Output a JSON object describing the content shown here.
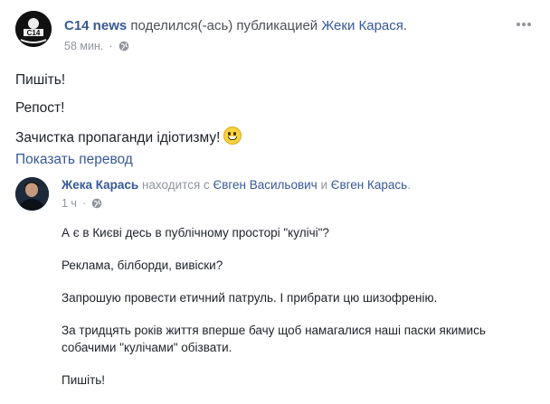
{
  "post": {
    "page_name": "C14 news",
    "action_text": "поделился(-ась) публикацией",
    "shared_from": "Жеки Карася",
    "period": ".",
    "time": "58 мин.",
    "avatar_text": "C14",
    "body_lines": [
      "Пишіть!",
      "Репост!",
      "Зачистка пропаганди ідіотизму!"
    ],
    "emoji": "grinning-face-icon",
    "translate_link": "Показать перевод"
  },
  "shared_post": {
    "author": "Жека Карась",
    "with_text": "находится с",
    "tagged_1": "Євген Васильович",
    "and_text": "и",
    "tagged_2": "Євген Карась",
    "period": ".",
    "time": "1 ч",
    "paragraphs": [
      "А є в Києві десь в публічному просторі \"кулічі\"?",
      "Реклама, білборди, вивіски?",
      "Запрошую провести етичний патруль. І прибрати цю шизофренію.",
      "За тридцять років життя вперше бачу щоб намагалися наші паски якимись собачими \"кулічами\" обізвати.",
      "Пишіть!"
    ]
  },
  "colors": {
    "link": "#365899",
    "meta_gray": "#90949c",
    "text": "#1d2129"
  }
}
